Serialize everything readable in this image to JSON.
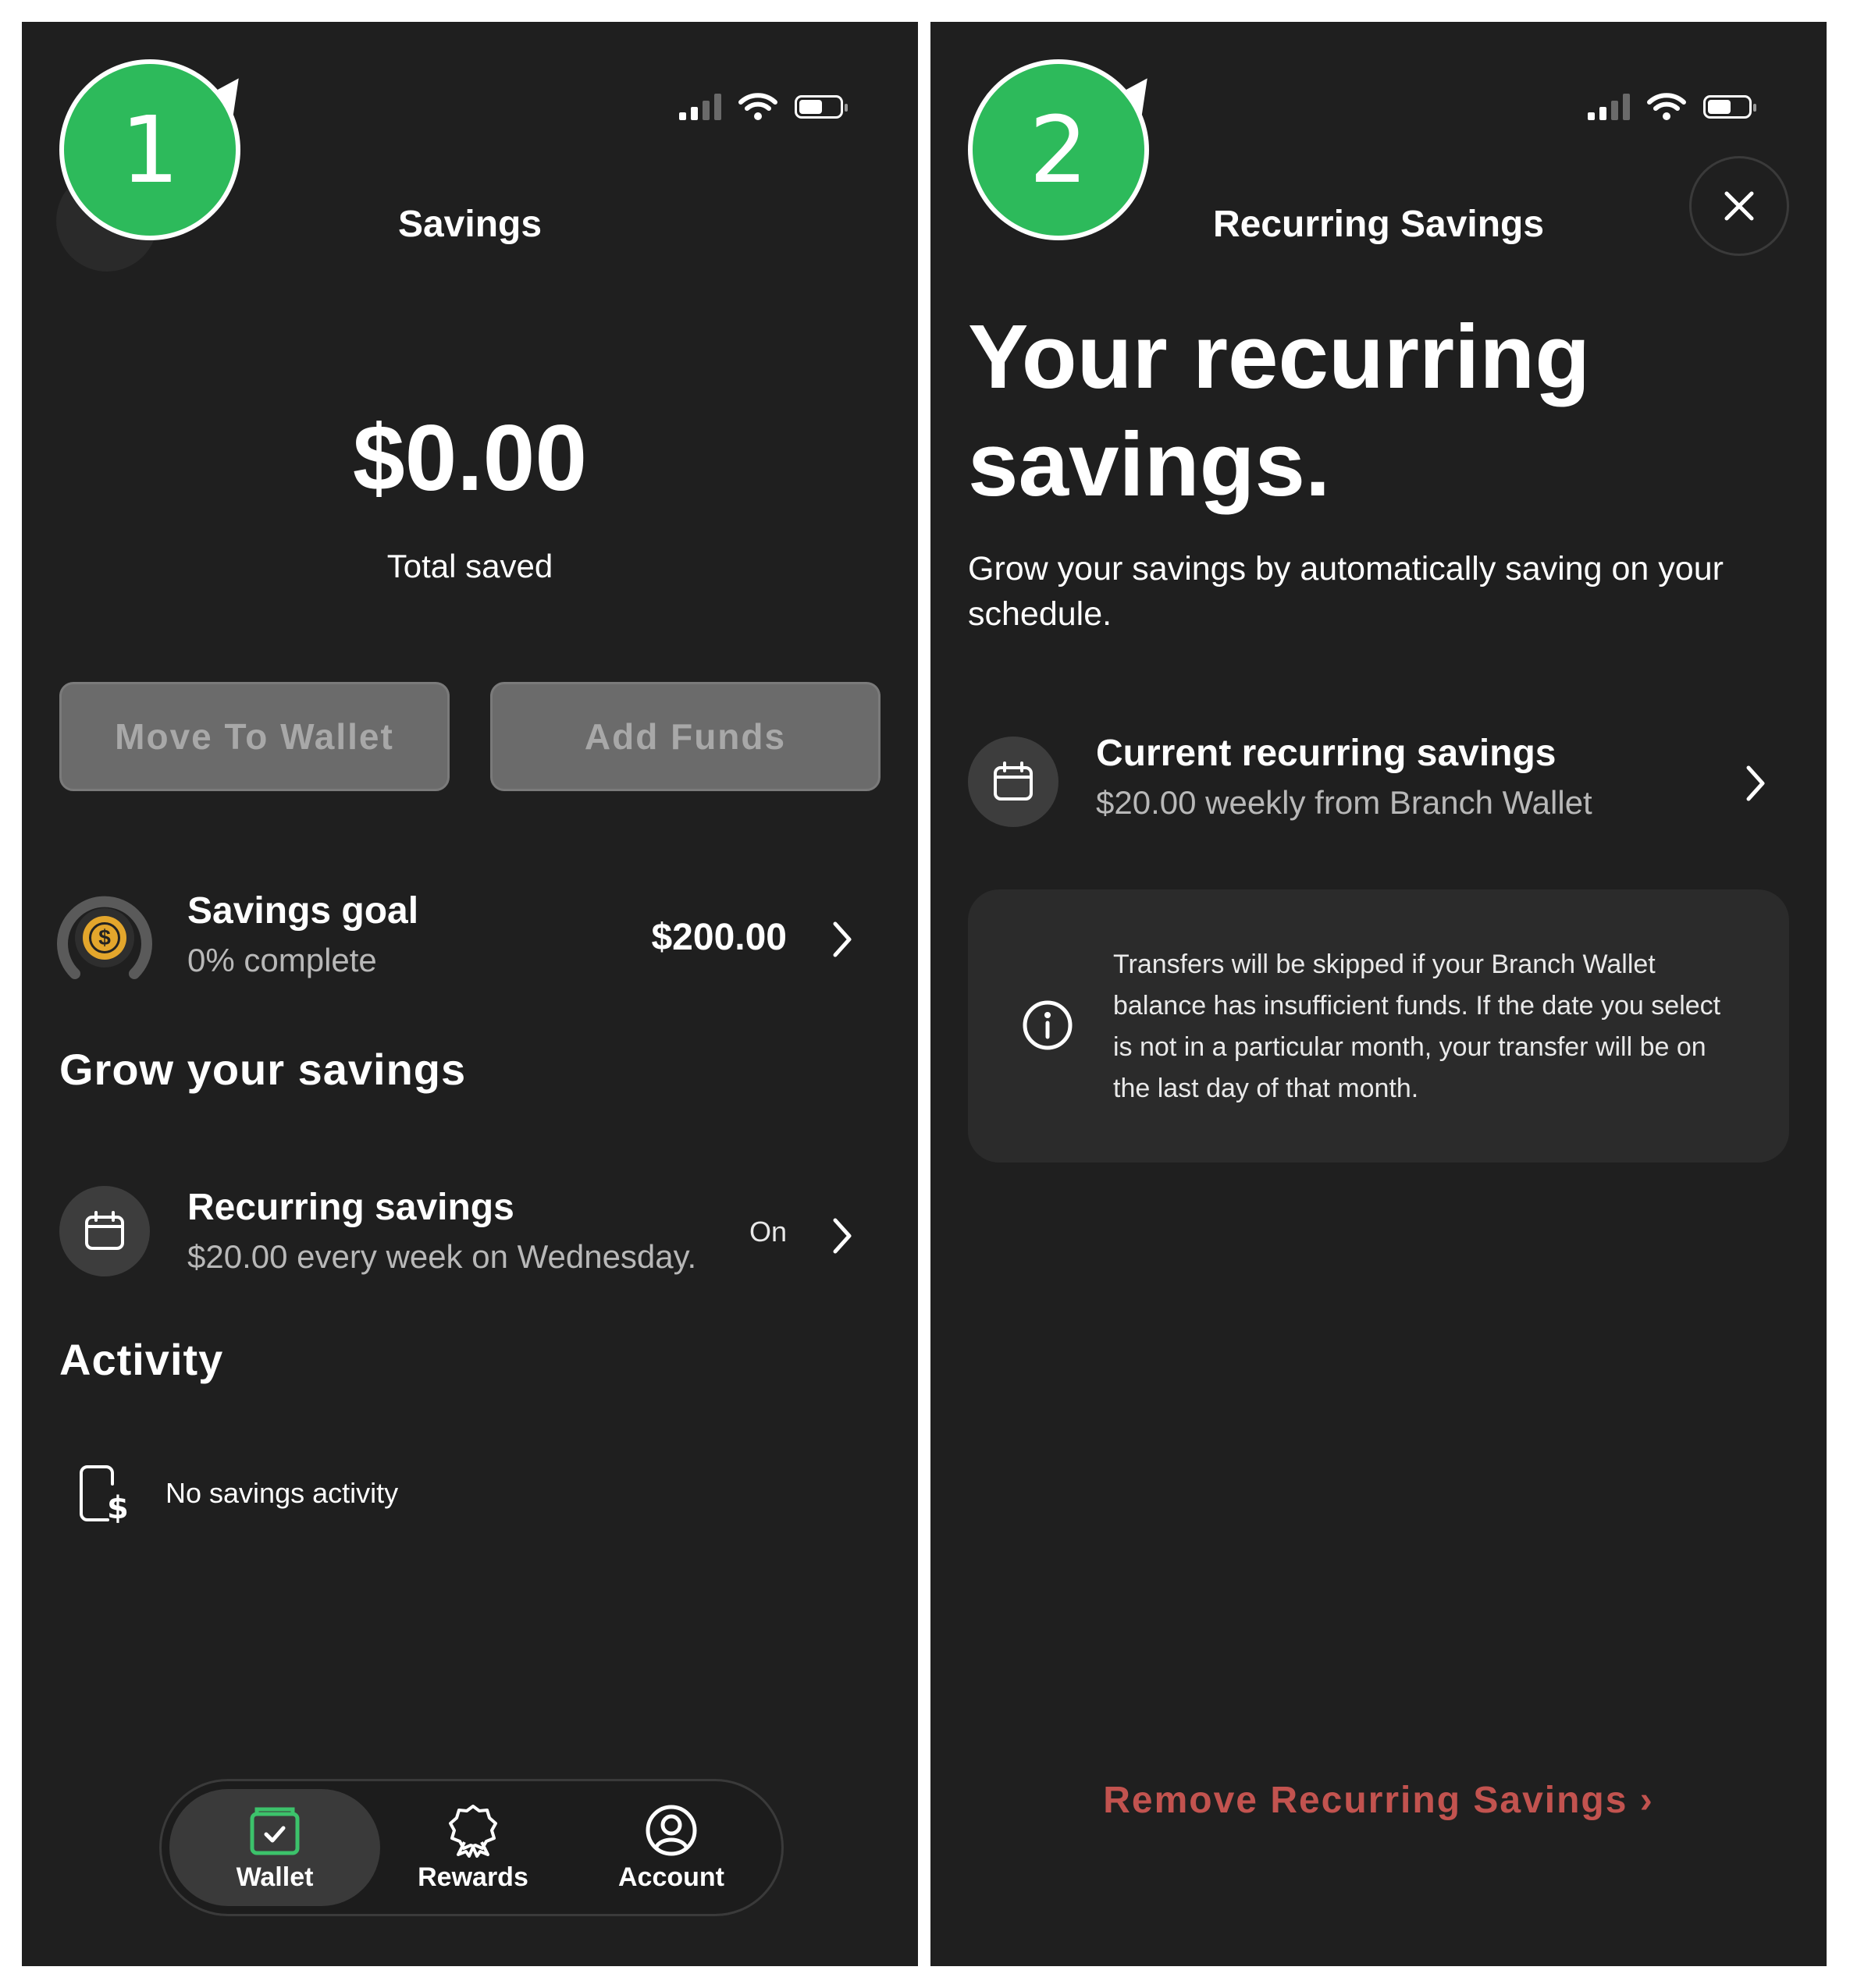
{
  "screen1": {
    "step": "1",
    "title": "Savings",
    "total_amount": "$0.00",
    "total_label": "Total saved",
    "buttons": {
      "move_to_wallet": "Move To Wallet",
      "add_funds": "Add Funds"
    },
    "savings_goal": {
      "title": "Savings goal",
      "subtitle": "0% complete",
      "amount": "$200.00",
      "progress": 0,
      "icon": "dollar-coin-icon"
    },
    "grow_heading": "Grow your savings",
    "recurring": {
      "title": "Recurring savings",
      "subtitle": "$20.00 every week on Wednesday.",
      "status": "On",
      "icon": "calendar-icon"
    },
    "activity_heading": "Activity",
    "activity_empty": {
      "text": "No savings activity",
      "icon": "phone-dollar-icon"
    },
    "tabs": [
      {
        "label": "Wallet",
        "icon": "wallet-icon",
        "active": true
      },
      {
        "label": "Rewards",
        "icon": "rewards-ribbon-icon",
        "active": false
      },
      {
        "label": "Account",
        "icon": "account-icon",
        "active": false
      }
    ]
  },
  "screen2": {
    "step": "2",
    "title": "Recurring Savings",
    "heading": "Your recurring savings.",
    "intro": "Grow your savings by automatically saving on your schedule.",
    "current": {
      "title": "Current recurring savings",
      "subtitle": "$20.00 weekly from Branch Wallet",
      "icon": "calendar-icon"
    },
    "info": {
      "text": "Transfers will be skipped if your Branch Wallet balance has insufficient funds. If the date you select is not in a particular month, your transfer will be on the last day of that month.",
      "icon": "info-icon"
    },
    "remove_label": "Remove Recurring Savings ›"
  },
  "colors": {
    "background": "#1f1f1f",
    "badge_green": "#2dba5b",
    "remove_red": "#c2534f",
    "wallet_green": "#3cc26b",
    "coin_gold": "#e3a62c"
  }
}
